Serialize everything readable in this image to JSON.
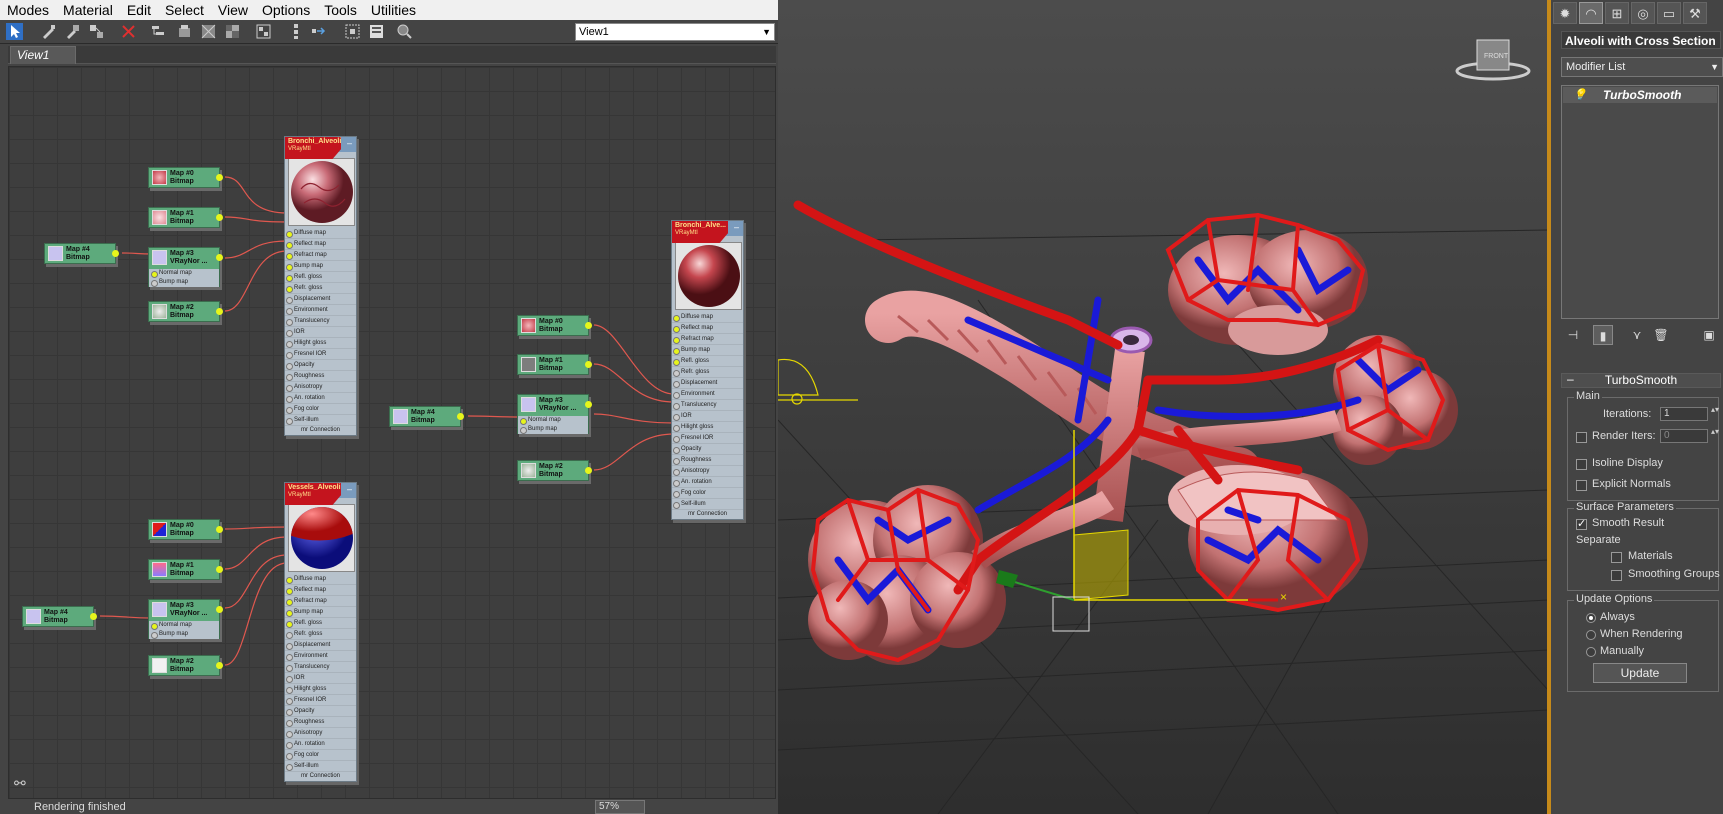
{
  "menus": [
    "Modes",
    "Material",
    "Edit",
    "Select",
    "View",
    "Options",
    "Tools",
    "Utilities"
  ],
  "view_select": "View1",
  "tab": "View1",
  "status": "Rendering finished",
  "zoom": "57%",
  "map_labels": {
    "map0": "Map #0",
    "map1": "Map #1",
    "map2": "Map #2",
    "map3": "Map #3",
    "map4": "Map #4",
    "bitmap": "Bitmap",
    "vraynormal": "VRayNor ...",
    "normal_map": "Normal map",
    "bump_map": "Bump map"
  },
  "materials": {
    "m1_name": "Bronchi_Alveoli",
    "m1_type": "VRayMtl",
    "m2_name": "Bronchi_Alve...",
    "m2_type": "VRayMtl",
    "m3_name": "Vessels_Alveoli",
    "m3_type": "VRayMtl",
    "slots": [
      "Diffuse map",
      "Reflect map",
      "Refract map",
      "Bump map",
      "Refl. gloss",
      "Refr. gloss",
      "Displacement",
      "Environment",
      "Translucency",
      "IOR",
      "Hilight gloss",
      "Fresnel IOR",
      "Opacity",
      "Roughness",
      "Anisotropy",
      "An. rotation",
      "Fog color",
      "Self-illum"
    ],
    "footer": "mr Connection"
  },
  "cube_label": "FRONT",
  "command_panel": {
    "object_name": "Alveoli with Cross Section",
    "modifier_list": "Modifier List",
    "stack_item": "TurboSmooth",
    "rollout": "TurboSmooth",
    "main": "Main",
    "iterations_label": "Iterations:",
    "iterations": "1",
    "render_iters_label": "Render Iters:",
    "render_iters": "0",
    "render_iters_checked": false,
    "isoline": "Isoline Display",
    "isoline_checked": false,
    "explicit": "Explicit Normals",
    "explicit_checked": false,
    "surface": "Surface Parameters",
    "smooth_result": "Smooth Result",
    "smooth_result_checked": true,
    "separate": "Separate",
    "materials": "Materials",
    "smoothing_groups": "Smoothing Groups",
    "update_options": "Update Options",
    "always": "Always",
    "when_rendering": "When Rendering",
    "manually": "Manually",
    "update_option_selected": "Always",
    "update_btn": "Update"
  },
  "colors": {
    "vessel_red": "#d41414",
    "vessel_blue": "#1a1ad8",
    "tissue": "#d98a8a",
    "gizmo_yellow": "#e6d800",
    "accent_orange": "#c68a1a",
    "node_green": "#5daa7c",
    "wire_red": "#e0584f"
  }
}
